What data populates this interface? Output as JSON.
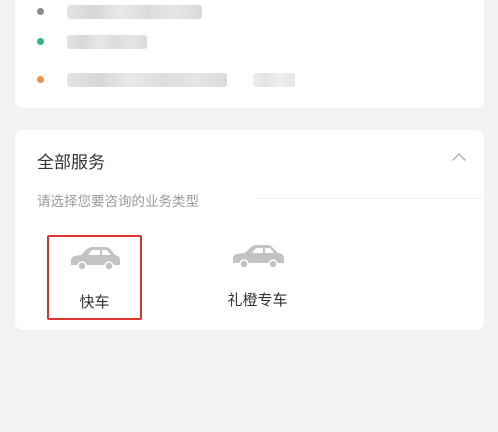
{
  "trip": {
    "rows": [
      {
        "dot_color": "#8a8a8a"
      },
      {
        "dot_color": "#2fb58d"
      },
      {
        "dot_color": "#f2914a"
      }
    ]
  },
  "services": {
    "title": "全部服务",
    "hint": "请选择您要咨询的业务类型",
    "items": [
      {
        "label": "快车",
        "icon": "car-icon",
        "selected": true
      },
      {
        "label": "礼橙专车",
        "icon": "car-icon",
        "selected": false
      }
    ]
  },
  "colors": {
    "highlight": "#e0342f",
    "car_icon": "#c3c3c3"
  }
}
